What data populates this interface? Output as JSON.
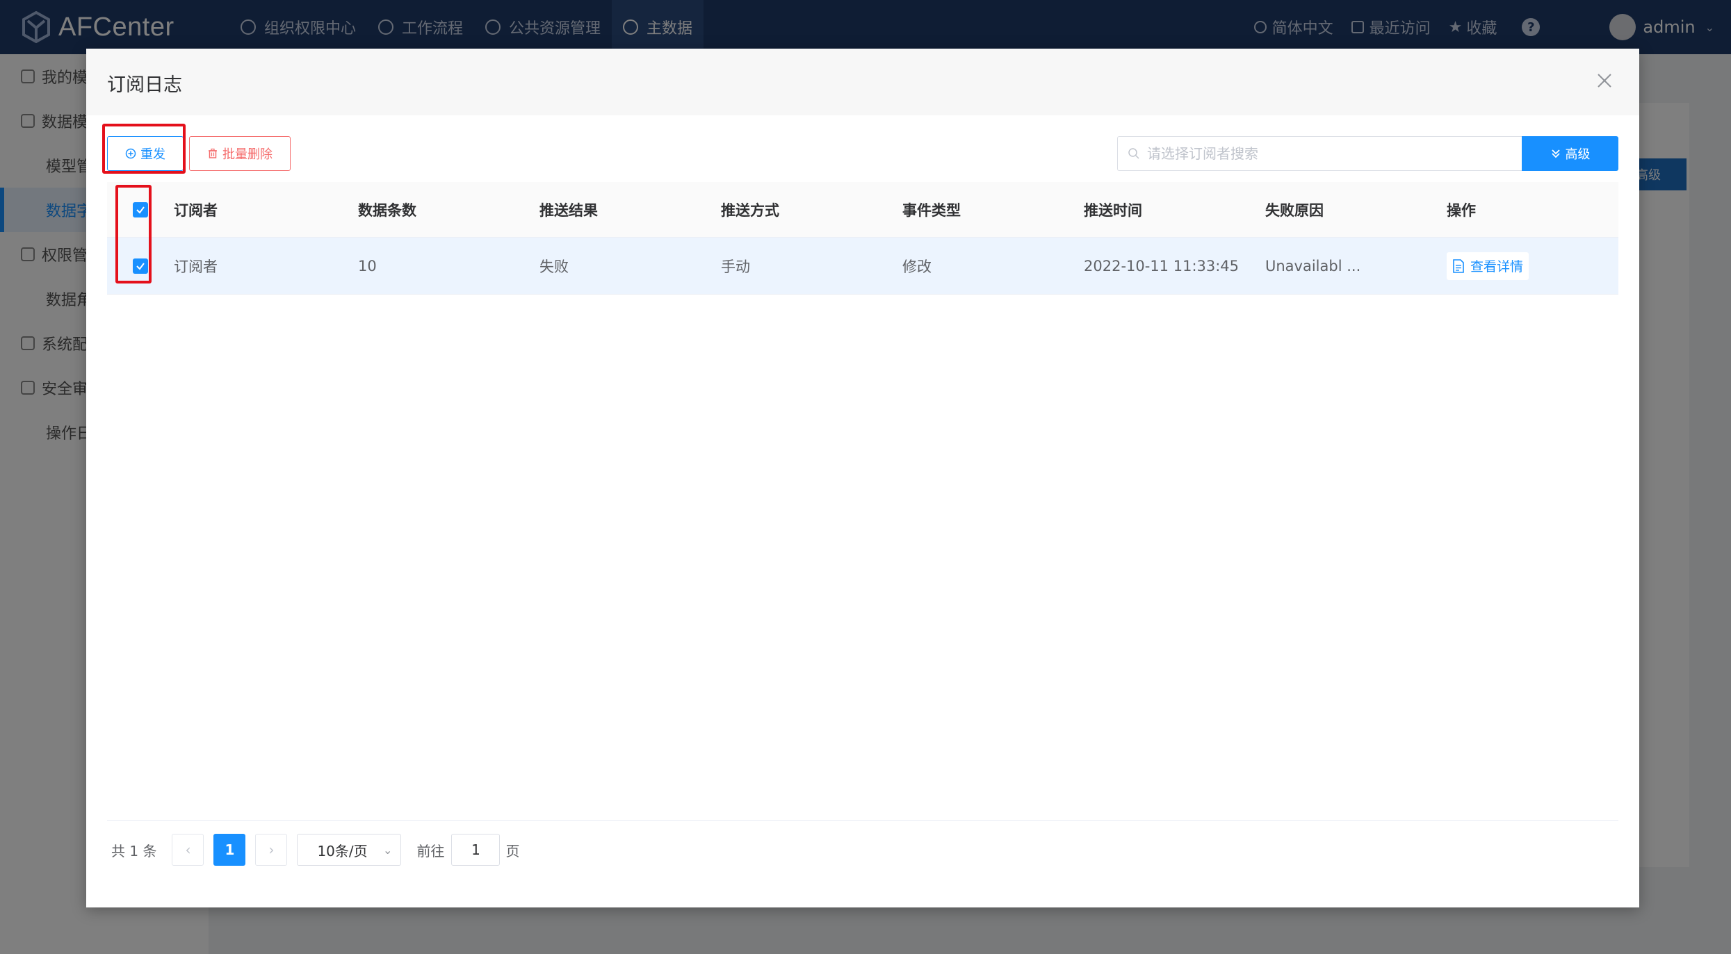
{
  "app": {
    "logo_text": "AFCenter",
    "nav": [
      {
        "label": "组织权限中心",
        "icon": "org-icon"
      },
      {
        "label": "工作流程",
        "icon": "workflow-icon"
      },
      {
        "label": "公共资源管理",
        "icon": "resource-icon"
      },
      {
        "label": "主数据",
        "icon": "masterdata-icon"
      }
    ],
    "lang_label": "简体中文",
    "recent_label": "最近访问",
    "favorite_label": "收藏",
    "user_name": "admin"
  },
  "sidebar": {
    "items": [
      {
        "label": "我的模",
        "type": "group"
      },
      {
        "label": "数据模",
        "type": "group"
      },
      {
        "label": "模型管",
        "type": "sub"
      },
      {
        "label": "数据字",
        "type": "sub-active"
      },
      {
        "label": "权限管",
        "type": "group"
      },
      {
        "label": "数据角",
        "type": "sub"
      },
      {
        "label": "系统配",
        "type": "group"
      },
      {
        "label": "安全审",
        "type": "group"
      },
      {
        "label": "操作日",
        "type": "sub"
      }
    ]
  },
  "background": {
    "adv_label": "高级"
  },
  "dialog": {
    "title": "订阅日志",
    "resend_label": "重发",
    "batch_delete_label": "批量删除",
    "search_placeholder": "请选择订阅者搜索",
    "advanced_label": "高级",
    "columns": [
      "订阅者",
      "数据条数",
      "推送结果",
      "推送方式",
      "事件类型",
      "推送时间",
      "失败原因",
      "操作"
    ],
    "rows": [
      {
        "subscriber": "订阅者",
        "count": "10",
        "result": "失败",
        "mode": "手动",
        "event": "修改",
        "time": "2022-10-11 11:33:45",
        "fail_reason": "Unavailabl ...",
        "action": "查看详情",
        "checked": true
      }
    ],
    "pager": {
      "total_text": "共 1 条",
      "current_page": "1",
      "page_size": "10条/页",
      "goto_label": "前往",
      "goto_value": "1",
      "page_suffix": "页"
    }
  },
  "colors": {
    "primary": "#1890ff",
    "danger": "#f56c6c",
    "highlight": "#e4101b",
    "topbar": "#1f3a68"
  }
}
